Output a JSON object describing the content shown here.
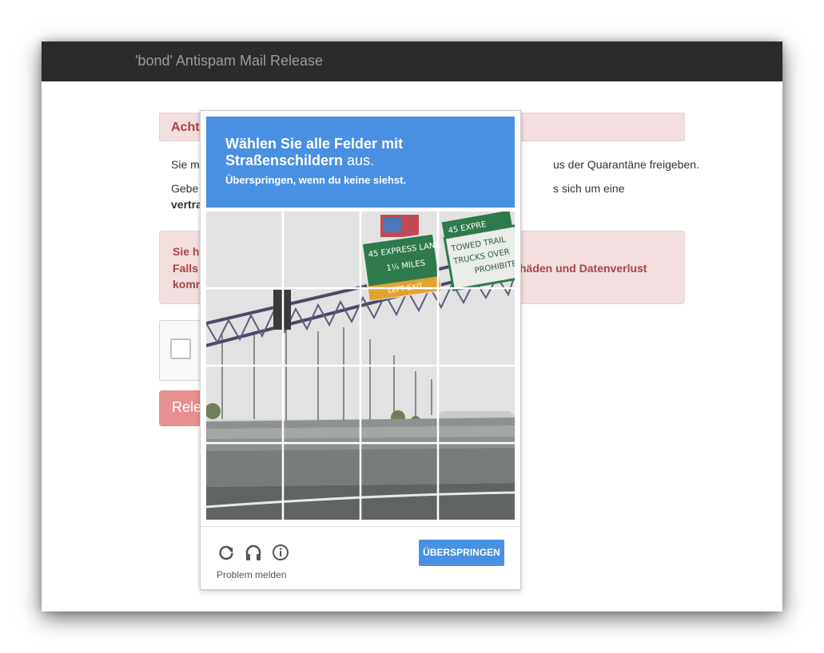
{
  "app": {
    "title": "'bond' Antispam Mail Release"
  },
  "alert": {
    "heading": "Acht"
  },
  "paragraph1": {
    "left": "Sie m",
    "right": "us der Quarantäne freigeben."
  },
  "paragraph2": {
    "left": "Gebe",
    "right": "s sich um eine",
    "bold": "vertra"
  },
  "warning": {
    "line1": "Sie h",
    "line2": "Falls",
    "line3": "komm",
    "line2_right": "häden und Datenverlust"
  },
  "release_button": {
    "label": "Rele"
  },
  "challenge": {
    "title_line1": "Wählen Sie alle Felder mit",
    "keyword": "Straßenschildern",
    "title_suffix": " aus.",
    "subtitle": "Überspringen, wenn du keine siehst.",
    "skip_label": "ÜBERSPRINGEN",
    "report_label": "Problem melden",
    "grid_size": 4,
    "sign_texts": {
      "green_sign_line1": "45 EXPRESS LANE",
      "green_sign_line2": "1¼ MILES",
      "green_sign_line3": "LEFT EXIT",
      "white_sign_line1": "TOWED TRAIL",
      "white_sign_line2": "TRUCKS OVER",
      "white_sign_line3": "PROHIBITE",
      "top_right_sign": "45 EXPRE"
    }
  },
  "colors": {
    "topbar": "#2b2b2b",
    "challenge_blue": "#4a90e2",
    "alert_red_text": "#a94442",
    "alert_bg": "#f2dede",
    "release_button": "#e6908f"
  },
  "icons": [
    "reload-icon",
    "headphones-icon",
    "info-icon"
  ]
}
